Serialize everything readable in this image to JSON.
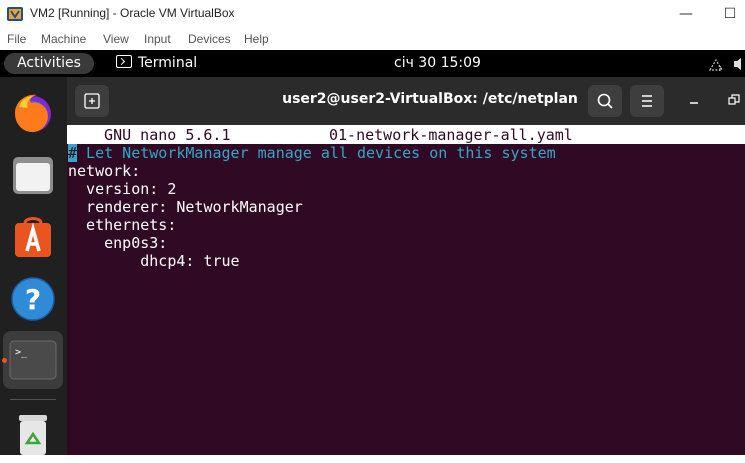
{
  "host": {
    "title": "VM2 [Running] - Oracle VM VirtualBox",
    "menu": [
      "File",
      "Machine",
      "View",
      "Input",
      "Devices",
      "Help"
    ]
  },
  "topbar": {
    "activities": "Activities",
    "app_name": "Terminal",
    "clock": "січ 30  15:09"
  },
  "dock": {
    "items": [
      "firefox-icon",
      "files-icon",
      "software-icon",
      "help-icon",
      "terminal-icon",
      "trash-icon"
    ]
  },
  "terminal": {
    "title": "user2@user2-VirtualBox: /etc/netplan",
    "nano_version": "  GNU nano 5.6.1",
    "file_name": "01-network-manager-all.yaml",
    "comment_cursor": "#",
    "comment_text": " Let NetworkManager manage all devices on this system",
    "lines": [
      "network:",
      "  version: 2",
      "  renderer: NetworkManager",
      "  ethernets:",
      "    enp0s3:",
      "        dhcp4: true"
    ]
  },
  "colors": {
    "terminal_bg": "#300a24",
    "comment": "#34a6c7",
    "ubuntu_orange": "#e95420"
  }
}
